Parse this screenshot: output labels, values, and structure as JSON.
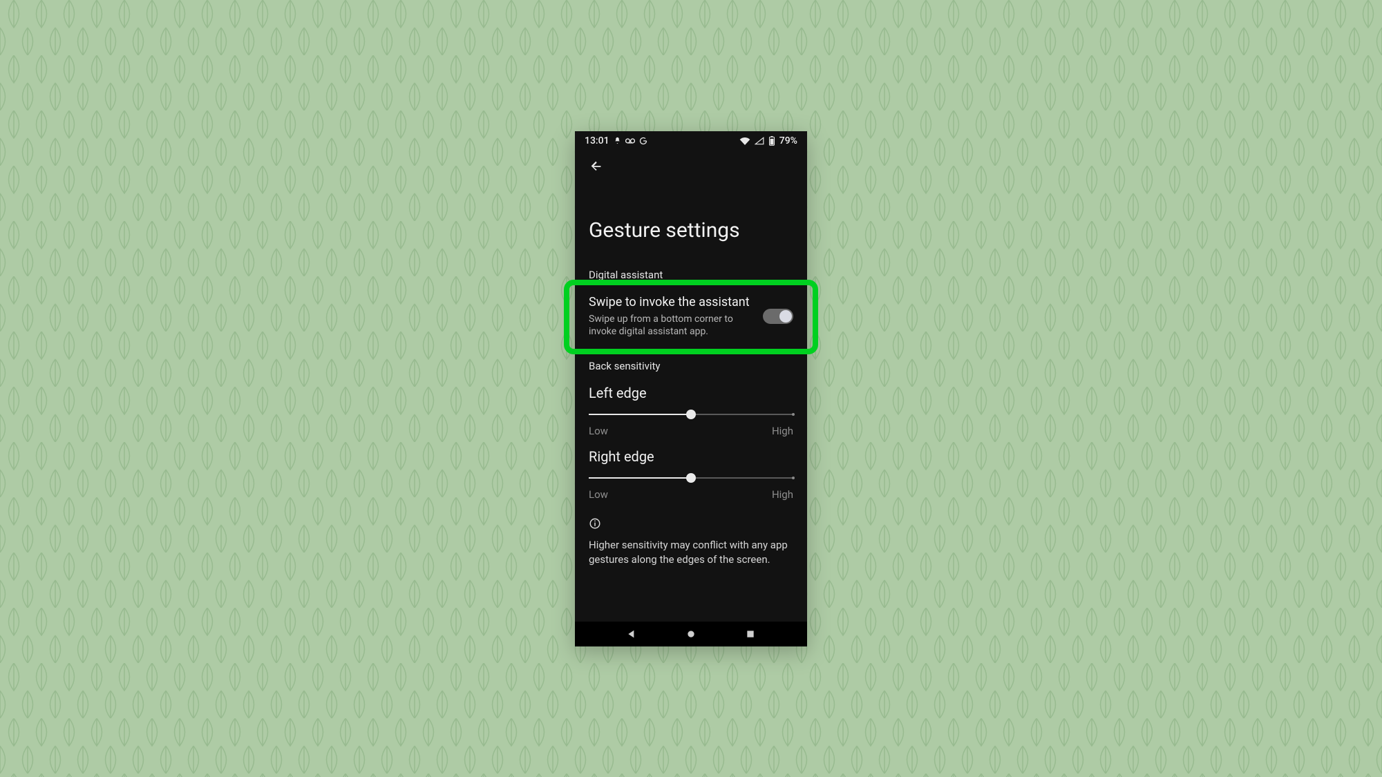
{
  "status": {
    "time": "13:01",
    "battery_text": "79%"
  },
  "appbar": {
    "back_icon": "arrow-back"
  },
  "title": "Gesture settings",
  "sections": {
    "digital_assistant_label": "Digital assistant",
    "swipe_assistant": {
      "title": "Swipe to invoke the assistant",
      "desc": "Swipe up from a bottom corner to invoke digital assistant app.",
      "toggle_on": true
    },
    "back_sensitivity_label": "Back sensitivity",
    "left_edge": {
      "title": "Left edge",
      "low": "Low",
      "high": "High",
      "value_pct": 50
    },
    "right_edge": {
      "title": "Right edge",
      "low": "Low",
      "high": "High",
      "value_pct": 50
    },
    "info": "Higher sensitivity may conflict with any app gestures along the edges of the screen."
  },
  "nav": {
    "back": "back-triangle",
    "home": "home-circle",
    "recents": "recents-square"
  }
}
